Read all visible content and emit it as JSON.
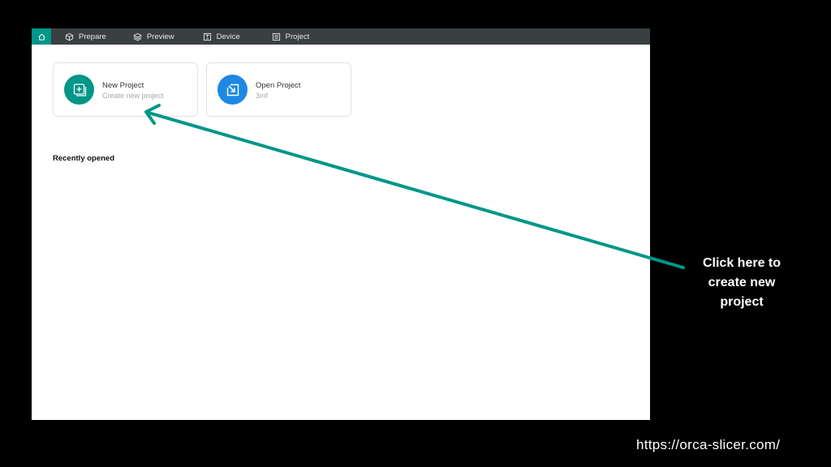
{
  "topbar": {
    "tabs": [
      {
        "label": "Prepare",
        "icon": "cube-icon"
      },
      {
        "label": "Preview",
        "icon": "layers-icon"
      },
      {
        "label": "Device",
        "icon": "device-icon"
      },
      {
        "label": "Project",
        "icon": "list-icon"
      }
    ],
    "active_color": "#009688"
  },
  "home": {
    "cards": [
      {
        "title": "New Project",
        "subtitle": "Create new project",
        "icon": "new-project-icon",
        "color": "#009688"
      },
      {
        "title": "Open Project",
        "subtitle": "3mf",
        "icon": "open-project-icon",
        "color": "#1e88e5"
      }
    ],
    "recent_title": "Recently opened"
  },
  "annotation": {
    "callout_lines": [
      "Click here to",
      "create new",
      "project"
    ],
    "arrow_color": "#009688"
  },
  "footer": {
    "url": "https://orca-slicer.com/"
  }
}
